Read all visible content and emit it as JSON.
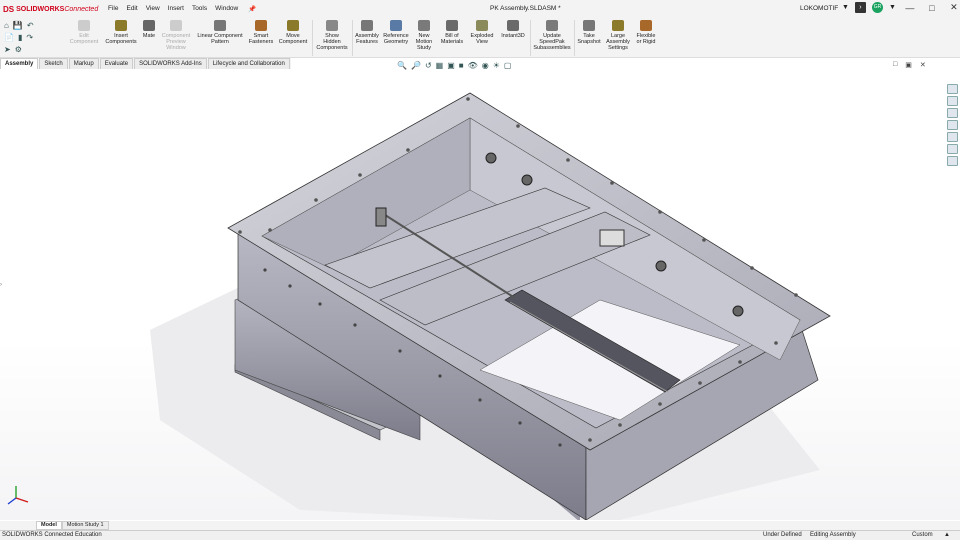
{
  "app": {
    "ds": "DS",
    "brand": "SOLIDWORKS",
    "brand_suffix": "Connected"
  },
  "menus": [
    "File",
    "Edit",
    "View",
    "Insert",
    "Tools",
    "Window"
  ],
  "document_title": "PK Assembly.SLDASM *",
  "user": "LOKOMOTIF",
  "avatar_initials": "GR",
  "ribbon": {
    "edit_component": "Edit\nComponent",
    "insert_components": "Insert\nComponents",
    "mate": "Mate",
    "component_preview": "Component\nPreview\nWindow",
    "linear_pattern": "Linear Component\nPattern",
    "smart_fasteners": "Smart\nFasteners",
    "move_component": "Move\nComponent",
    "show_hidden": "Show\nHidden\nComponents",
    "assembly_features": "Assembly\nFeatures",
    "reference_geometry": "Reference\nGeometry",
    "new_motion_study": "New\nMotion\nStudy",
    "bill_of_materials": "Bill of\nMaterials",
    "exploded_view": "Exploded\nView",
    "instant3d": "Instant3D",
    "speedpak": "Update\nSpeedPak\nSubassemblies",
    "take_snapshot": "Take\nSnapshot",
    "large_assembly": "Large\nAssembly\nSettings",
    "flexible": "Flexible\nor Rigid"
  },
  "tabs": [
    "Assembly",
    "Sketch",
    "Markup",
    "Evaluate",
    "SOLIDWORKS Add-Ins",
    "Lifecycle and Collaboration"
  ],
  "bottom_tabs": [
    "Model",
    "Motion Study 1"
  ],
  "status": {
    "product": "SOLIDWORKS Connected Education",
    "defined": "Under Defined",
    "editing": "Editing Assembly",
    "units": "Custom",
    "arrow": "▲"
  },
  "colors": {
    "accent": "#d0021b",
    "metal_light": "#c6c6d0",
    "metal_mid": "#a4a4b0",
    "metal_dark": "#6e6e7c"
  }
}
